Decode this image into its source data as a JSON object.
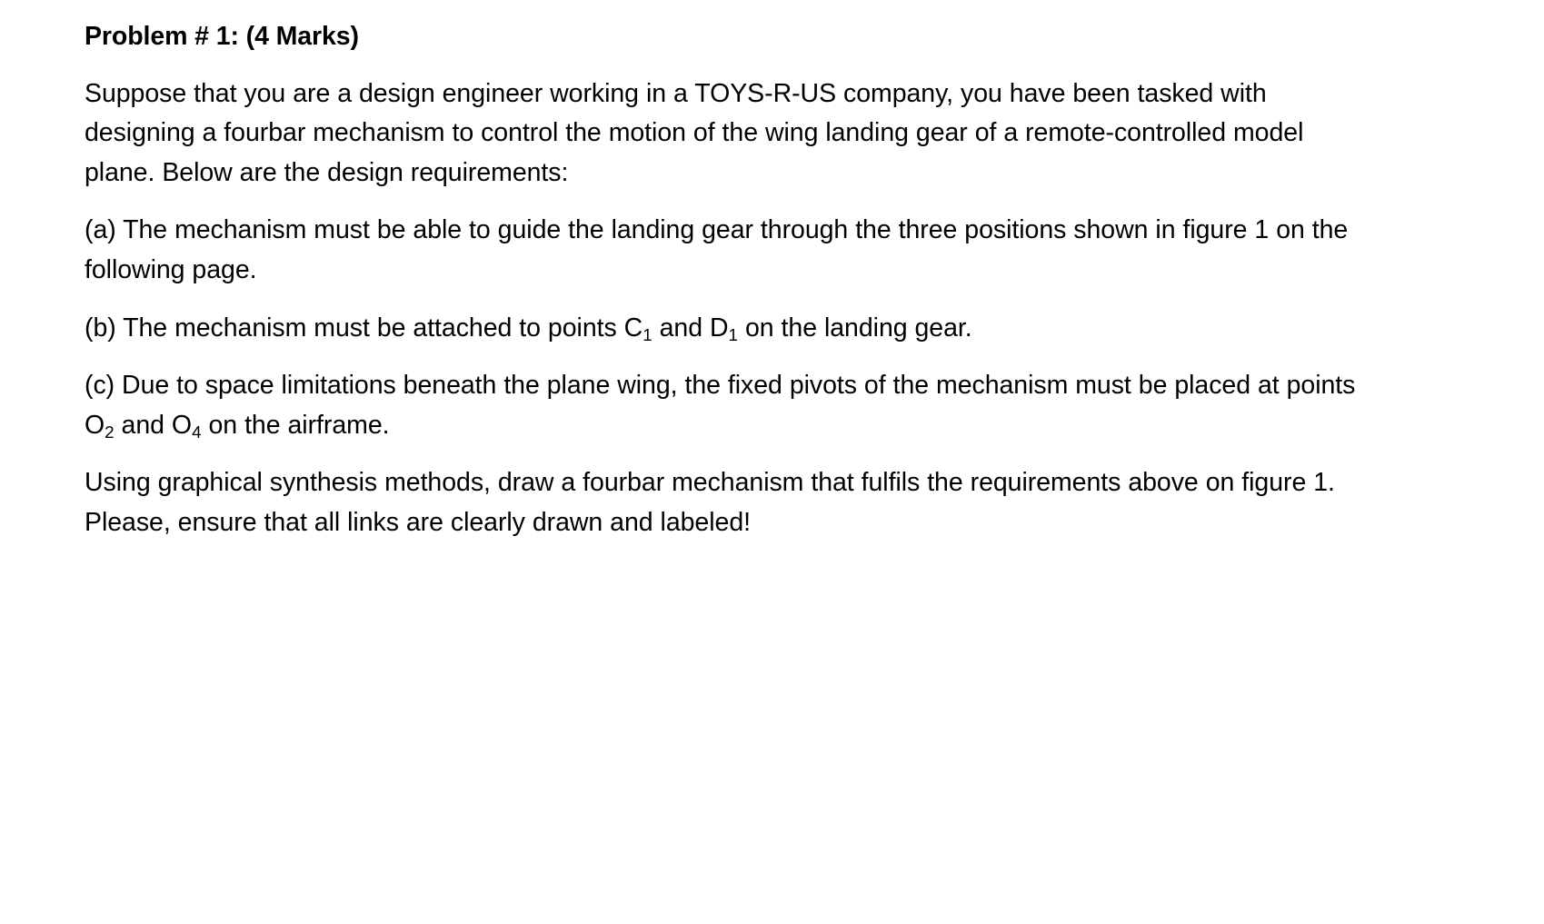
{
  "document": {
    "heading": "Problem # 1: (4 Marks)",
    "paragraphs": {
      "intro": "Suppose that you are a design engineer working in a TOYS-R-US company, you have been tasked with designing a fourbar mechanism to control the motion of the wing landing gear of a remote-controlled model plane. Below are the design requirements:",
      "item_a": "(a) The mechanism must be able to guide the landing gear through the three positions shown in figure 1 on the following page.",
      "item_b_prefix": "(b) The mechanism must be attached to points C",
      "item_b_sub1": "1",
      "item_b_middle": " and D",
      "item_b_sub2": "1",
      "item_b_suffix": " on the landing gear.",
      "item_c_line1": "(c) Due to space limitations beneath the plane wing, the fixed pivots of the mechanism must be placed at points O",
      "item_c_sub1": "2",
      "item_c_middle": " and O",
      "item_c_sub2": "4",
      "item_c_suffix": " on the airframe.",
      "closing": "Using graphical synthesis methods, draw a fourbar mechanism that fulfils the requirements above on figure 1. Please, ensure that all links are clearly drawn and labeled!"
    }
  },
  "style": {
    "text_color": "#000000",
    "background_color": "#ffffff"
  }
}
